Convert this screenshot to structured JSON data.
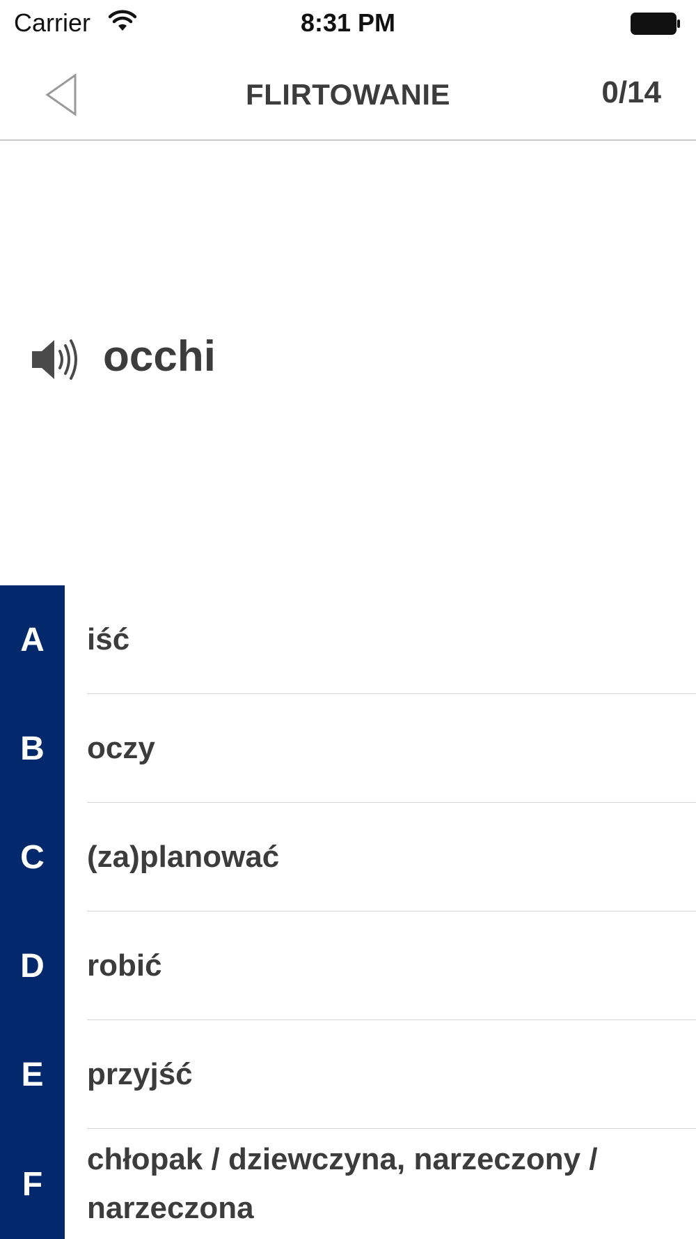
{
  "status_bar": {
    "carrier": "Carrier",
    "time": "8:31 PM",
    "wifi_icon": "wifi-icon",
    "battery_icon": "battery-icon"
  },
  "header": {
    "back_icon": "back-triangle-icon",
    "title": "FLIRTOWANIE",
    "progress": "0/14"
  },
  "prompt": {
    "speaker_icon": "speaker-icon",
    "word": "occhi"
  },
  "answers": [
    {
      "letter": "A",
      "text": "iść"
    },
    {
      "letter": "B",
      "text": "oczy"
    },
    {
      "letter": "C",
      "text": "(za)planować"
    },
    {
      "letter": "D",
      "text": "robić"
    },
    {
      "letter": "E",
      "text": "przyjść"
    },
    {
      "letter": "F",
      "text": "chłopak / dziewczyna, narzeczony / narzeczona"
    }
  ],
  "colors": {
    "letter_tab": "#03296c",
    "text": "#3c3c3c",
    "divider": "#d4d4d4"
  }
}
